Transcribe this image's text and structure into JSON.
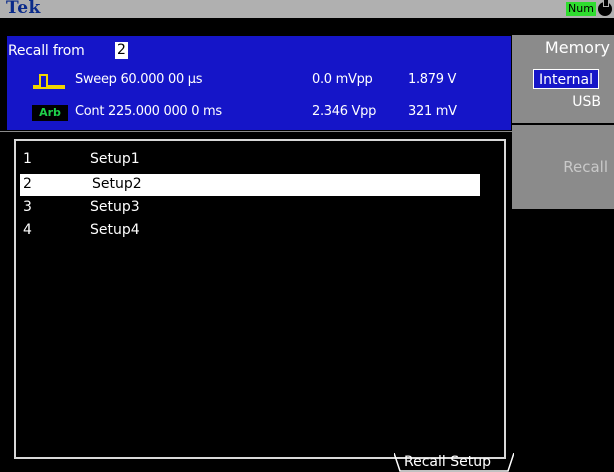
{
  "topbar": {
    "brand": "Tek",
    "badge": "Num",
    "status_icon": "power-icon"
  },
  "header": {
    "recall_label": "Recall from",
    "recall_slot": "2",
    "ch1": {
      "icon": "pulse-waveform-icon",
      "mode": "Sweep 60.000 00 µs",
      "amplitude": "0.0 mVpp",
      "offset": "1.879 V"
    },
    "ch2": {
      "icon": "Arb",
      "mode": "Cont   225.000 000 0 ms",
      "amplitude": "2.346 Vpp",
      "offset": "321 mV"
    }
  },
  "list": {
    "items": [
      {
        "num": "1",
        "name": "Setup1"
      },
      {
        "num": "2",
        "name": "Setup2"
      },
      {
        "num": "3",
        "name": "Setup3"
      },
      {
        "num": "4",
        "name": "Setup4"
      }
    ],
    "selected_index": 1
  },
  "softkeys": {
    "memory_title": "Memory",
    "memory_internal": "Internal",
    "memory_usb": "USB",
    "recall": "Recall"
  },
  "footer": {
    "tab_label": "Recall Setup"
  },
  "colors": {
    "header_blue": "#1515c8",
    "arb_green": "#1fd14a",
    "pulse_yellow": "#f1d500",
    "badge_green": "#2fdc2f"
  }
}
